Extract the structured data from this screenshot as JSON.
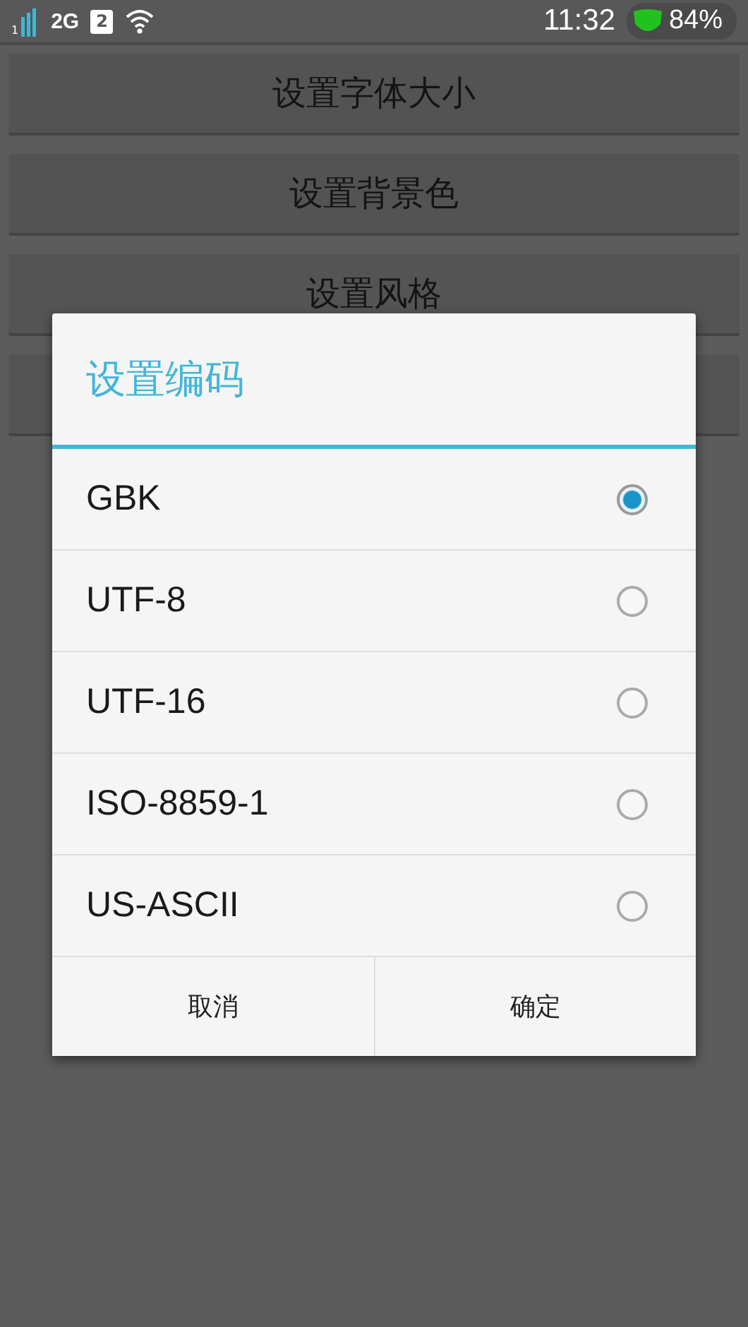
{
  "status_bar": {
    "signal_slot": "1",
    "network": "2G",
    "sim_slot": "2",
    "time": "11:32",
    "battery": "84%"
  },
  "buttons": [
    {
      "label": "设置字体大小"
    },
    {
      "label": "设置背景色"
    },
    {
      "label": "设置风格",
      "covered": true
    },
    {
      "covered": true
    }
  ],
  "dialog": {
    "title": "设置编码",
    "options": [
      {
        "label": "GBK",
        "selected": true
      },
      {
        "label": "UTF-8",
        "selected": false
      },
      {
        "label": "UTF-16",
        "selected": false
      },
      {
        "label": "ISO-8859-1",
        "selected": false
      },
      {
        "label": "US-ASCII",
        "selected": false
      }
    ],
    "actions": [
      "取消",
      "确定"
    ]
  }
}
